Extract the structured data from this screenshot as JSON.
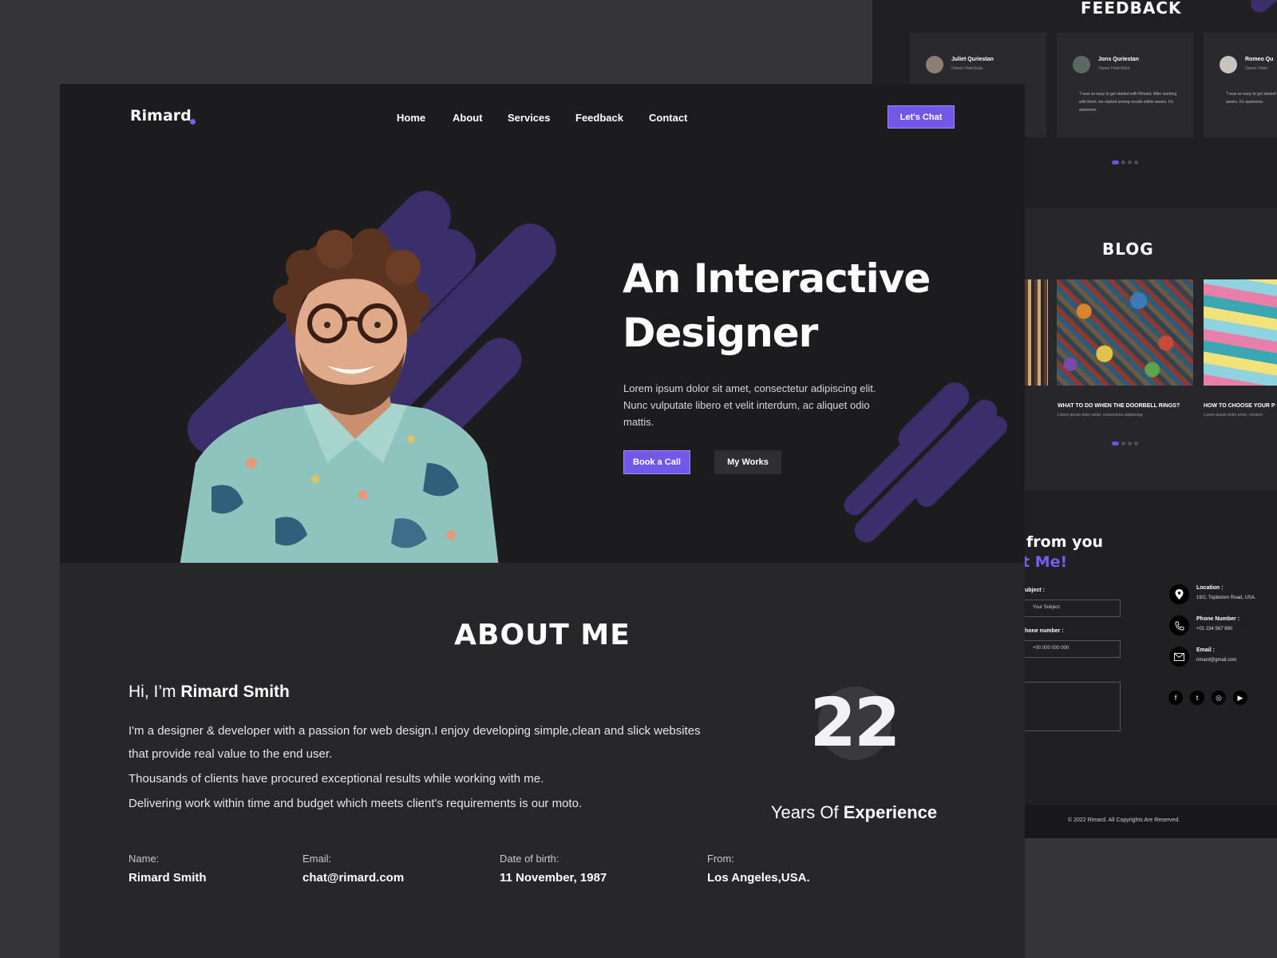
{
  "bg": {
    "feedback": {
      "title": "FEEDBACK",
      "cards": [
        {
          "name": "Juliet Quriestan",
          "role": "Owner Hotel Esta",
          "quote": ""
        },
        {
          "name": "Jons Quriestan",
          "role": "Owner Hotel Bela",
          "quote": "\"I was so easy to get started with Rimard. After working with them, we started seeing results within weeks. It's awesome."
        },
        {
          "name": "Romeo Qu",
          "role": "Owner Hotel",
          "quote": "\"I was so easy to get started working with them, we starte weeks. It's awesome."
        }
      ]
    },
    "blog": {
      "title": "BLOG",
      "posts": [
        {
          "title": "WHAT TO DO WHEN THE DOORBELL RINGS?",
          "excerpt": "Lorem ipsum dolor amet, consectetur adipiscing."
        },
        {
          "title": "HOW TO CHOOSE YOUR P",
          "excerpt": "Lorem ipsum dolor amet, consect"
        }
      ]
    },
    "contact": {
      "heading_line1": "from you",
      "heading_line2": "t Me!",
      "subject_label": "ubject :",
      "subject_placeholder": "Your Subject",
      "phone_label": "hone number :",
      "phone_placeholder": "+00 000 000 000",
      "info": [
        {
          "label": "Location :",
          "value": "19/2, Topbotom Road, USA."
        },
        {
          "label": "Phone Number :",
          "value": "+01 234 567 890"
        },
        {
          "label": "Email :",
          "value": "rimard@gmail.com"
        }
      ],
      "social_icons": [
        "facebook-icon",
        "twitter-icon",
        "instagram-icon",
        "youtube-icon"
      ]
    },
    "footer": {
      "copyright": "© 2022 Rimard. All Copyrights Are Reserved."
    }
  },
  "brand": {
    "logo": "Rimard",
    "accent": "#7258e8"
  },
  "nav": {
    "home": "Home",
    "about": "About",
    "services": "Services",
    "feedback": "Feedback",
    "contact": "Contact",
    "cta": "Let's Chat"
  },
  "hero": {
    "title_line1": "An Interactive",
    "title_line2": "Designer",
    "text": "Lorem ipsum dolor sit amet, consectetur adipiscing elit. Nunc vulputate libero et velit interdum, ac aliquet odio mattis.",
    "book_label": "Book a Call",
    "works_label": "My Works"
  },
  "about": {
    "title": "ABOUT ME",
    "greeting_prefix": "Hi, I’m",
    "greeting_name": "Rimard Smith",
    "p1": "I'm a designer & developer with a passion for web design.I enjoy developing simple,clean and slick websites that provide real value to the end user.",
    "p2": "Thousands of clients have procured exceptional results while working with me.",
    "p3": "Delivering work within time and budget which meets client's requirements is our moto.",
    "years": "22",
    "years_prefix": "Years Of",
    "years_bold": "Experience",
    "details": [
      {
        "label": "Name:",
        "value": "Rimard Smith"
      },
      {
        "label": "Email:",
        "value": "chat@rimard.com"
      },
      {
        "label": "Date of birth:",
        "value": "11 November, 1987"
      },
      {
        "label": "From:",
        "value": "Los Angeles,USA."
      }
    ]
  }
}
